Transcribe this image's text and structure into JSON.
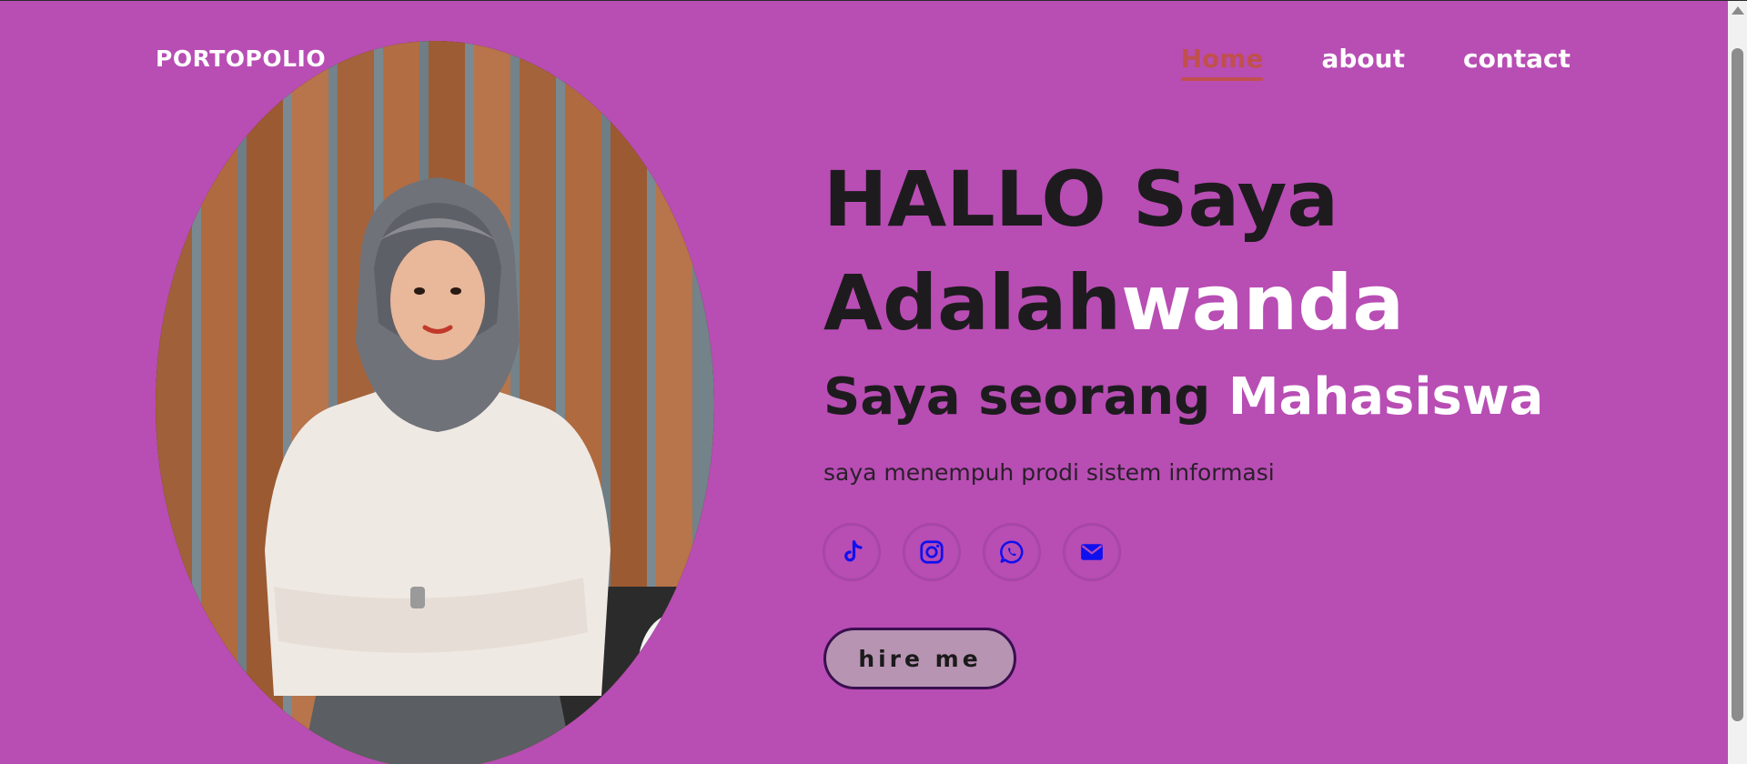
{
  "header": {
    "logo": "PORTOPOLIO",
    "nav": [
      {
        "label": "Home",
        "active": true
      },
      {
        "label": "about",
        "active": false
      },
      {
        "label": "contact",
        "active": false
      }
    ]
  },
  "hero": {
    "line1": "HALLO Saya",
    "line2_prefix": "Adalah",
    "line2_name": "wanda",
    "line3_prefix": "Saya seorang ",
    "line3_role": "Mahasiswa",
    "description": "saya menempuh prodi sistem informasi",
    "socials": [
      {
        "icon": "tiktok-icon"
      },
      {
        "icon": "instagram-icon"
      },
      {
        "icon": "whatsapp-icon"
      },
      {
        "icon": "email-icon"
      }
    ],
    "hire_label": "hire me"
  },
  "colors": {
    "background": "#b84db4",
    "accent_white": "#ffffff",
    "nav_active": "#c0504d",
    "icon_blue": "#1010ee",
    "button_bg": "#b794b2",
    "button_border": "#3a0f4f"
  }
}
